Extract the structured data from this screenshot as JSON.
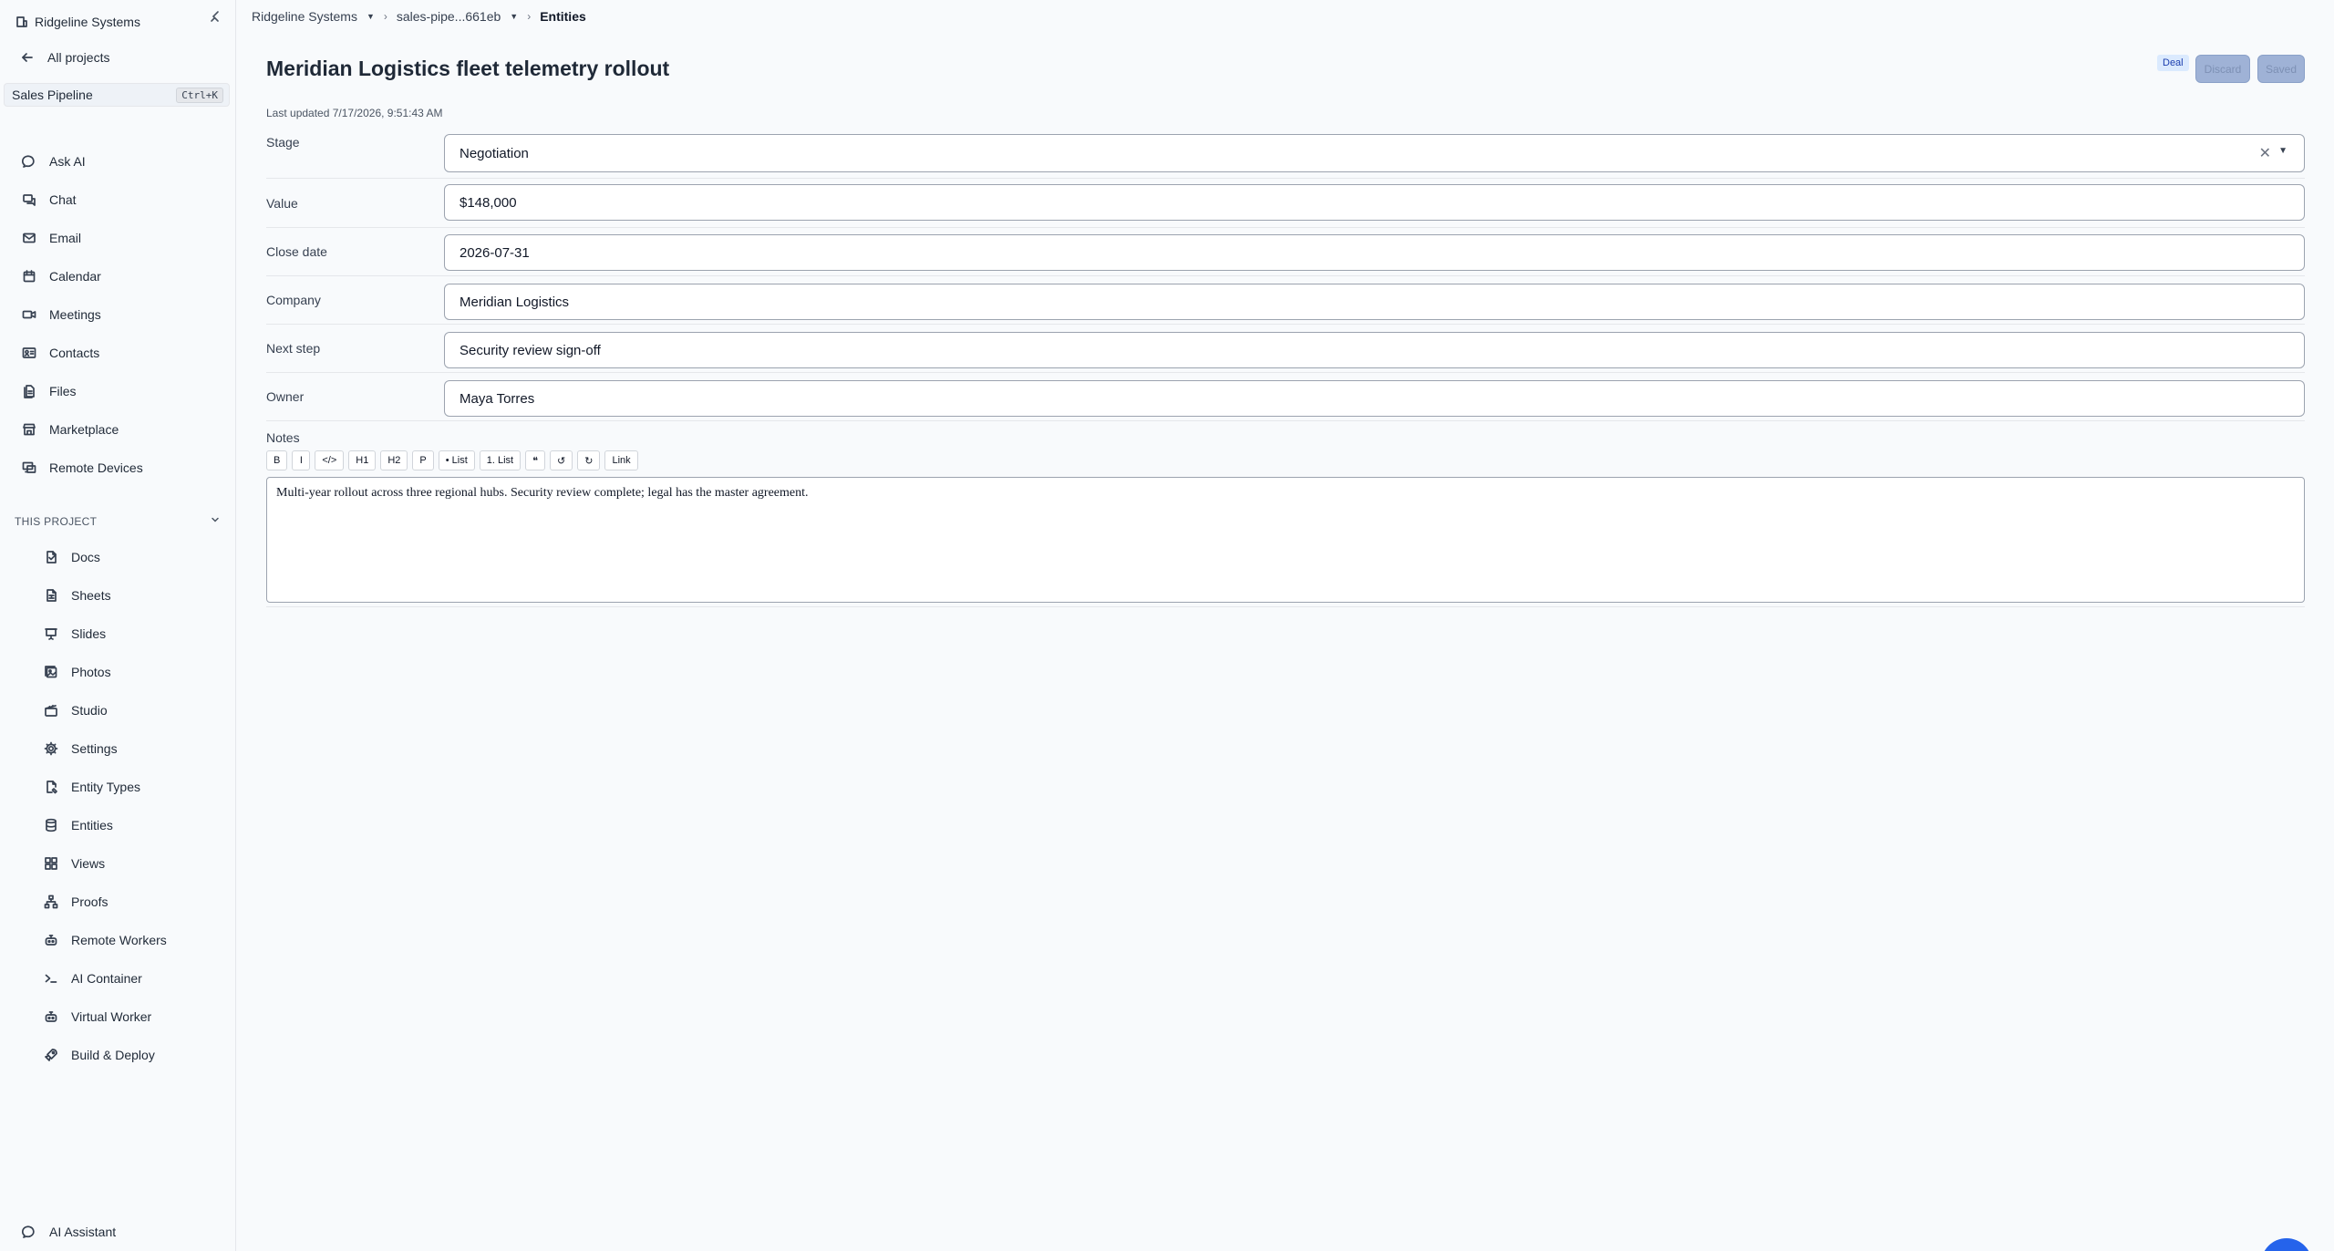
{
  "workspace": {
    "name": "Ridgeline Systems"
  },
  "sidebar": {
    "back_label": "All projects",
    "project": {
      "name": "Sales Pipeline",
      "shortcut": "Ctrl+K"
    },
    "main_items": [
      {
        "label": "Ask AI",
        "icon": "chat-bubble-icon"
      },
      {
        "label": "Chat",
        "icon": "chat-icon"
      },
      {
        "label": "Email",
        "icon": "mail-icon"
      },
      {
        "label": "Calendar",
        "icon": "calendar-icon"
      },
      {
        "label": "Meetings",
        "icon": "video-icon"
      },
      {
        "label": "Contacts",
        "icon": "contact-card-icon"
      },
      {
        "label": "Files",
        "icon": "files-icon"
      },
      {
        "label": "Marketplace",
        "icon": "store-icon"
      },
      {
        "label": "Remote Devices",
        "icon": "monitor-icon"
      }
    ],
    "section_label": "THIS PROJECT",
    "project_items": [
      {
        "label": "Docs",
        "icon": "doc-icon"
      },
      {
        "label": "Sheets",
        "icon": "sheet-icon"
      },
      {
        "label": "Slides",
        "icon": "presentation-icon"
      },
      {
        "label": "Photos",
        "icon": "photos-icon"
      },
      {
        "label": "Studio",
        "icon": "clapper-icon"
      },
      {
        "label": "Settings",
        "icon": "gear-icon"
      },
      {
        "label": "Entity Types",
        "icon": "doc-edit-icon"
      },
      {
        "label": "Entities",
        "icon": "database-icon"
      },
      {
        "label": "Views",
        "icon": "grid-icon"
      },
      {
        "label": "Proofs",
        "icon": "hierarchy-icon"
      },
      {
        "label": "Remote Workers",
        "icon": "robot-icon"
      },
      {
        "label": "AI Container",
        "icon": "terminal-icon"
      },
      {
        "label": "Virtual Worker",
        "icon": "robot-icon"
      },
      {
        "label": "Build & Deploy",
        "icon": "rocket-icon"
      }
    ],
    "assistant_label": "AI Assistant"
  },
  "breadcrumb": {
    "workspace": "Ridgeline Systems",
    "project": "sales-pipe...661eb",
    "current": "Entities"
  },
  "record": {
    "title": "Meridian Logistics fleet telemetry rollout",
    "updated": "Last updated 7/17/2026, 9:51:43 AM",
    "type_badge": "Deal",
    "discard_label": "Discard",
    "saved_label": "Saved",
    "fields": [
      {
        "label": "Stage",
        "value": "Negotiation"
      },
      {
        "label": "Value",
        "value": "$148,000"
      },
      {
        "label": "Close date",
        "value": "2026-07-31"
      },
      {
        "label": "Company",
        "value": "Meridian Logistics"
      },
      {
        "label": "Next step",
        "value": "Security review sign-off"
      },
      {
        "label": "Owner",
        "value": "Maya Torres"
      }
    ],
    "notes_label": "Notes",
    "toolbar": [
      "B",
      "I",
      "</>",
      "H1",
      "H2",
      "P",
      "• List",
      "1. List",
      "❝",
      "↺",
      "↻",
      "Link"
    ],
    "notes_text": "Multi-year rollout across three regional hubs. Security review complete; legal has the master agreement."
  }
}
